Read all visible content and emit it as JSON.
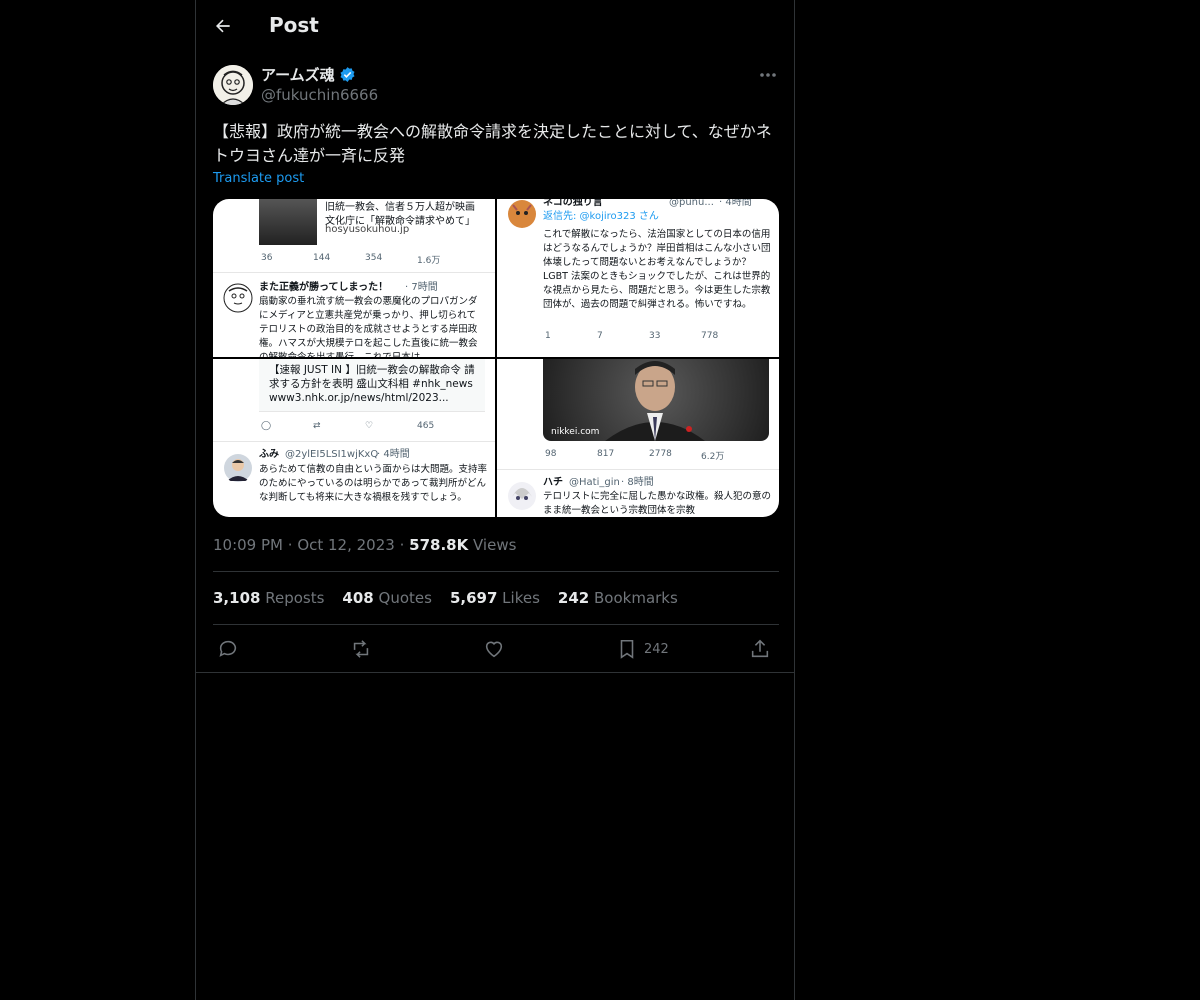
{
  "header": {
    "title": "Post"
  },
  "author": {
    "name": "アームズ魂",
    "handle": "@fukuchin6666"
  },
  "post": {
    "text": "【悲報】政府が統一教会への解散命令請求を決定したことに対して、なぜかネトウヨさん達が一斉に反発",
    "translate_label": "Translate post",
    "time": "10:09 PM",
    "date": "Oct 12, 2023",
    "views": "578.8K",
    "views_label": "Views"
  },
  "stats": {
    "reposts": "3,108",
    "reposts_label": "Reposts",
    "quotes": "408",
    "quotes_label": "Quotes",
    "likes": "5,697",
    "likes_label": "Likes",
    "bookmarks": "242",
    "bookmarks_label": "Bookmarks"
  },
  "actions": {
    "bookmark_count": "242"
  },
  "media": {
    "s1": {
      "card_title": "旧統一教会、信者５万人超が映画\n文化庁に「解散命令請求やめて」",
      "card_domain": "hosyusokuhou.jp",
      "m1": "36",
      "m2": "144",
      "m3": "354",
      "m4": "1.6万",
      "name": "また正義が勝ってしまった！",
      "time": "· 7時間",
      "body": "扇動家の垂れ流す統一教会の悪魔化のプロパガンダにメディアと立憲共産党が乗っかり、押し切られてテロリストの政治目的を成就させようとする岸田政権。ハマスが大規模テロを起こした直後に統一教会の解散命令を出す愚行、これで日本は"
    },
    "s2": {
      "name": "ネコの独り言",
      "handle": "@punu...",
      "time": "· 4時間",
      "reply_to": "返信先: @kojiro323 さん",
      "body": "これで解散になったら、法治国家としての日本の信用はどうなるんでしょうか？岸田首相はこんな小さい団体壊したって問題ないとお考えなんでしょうか？LGBT 法案のときもショックでしたが、これは世界的な視点から見たら、問題だと思う。今は更生した宗教団体が、過去の問題で糾弾される。怖いですね。",
      "m1": "1",
      "m2": "7",
      "m3": "33",
      "m4": "778"
    },
    "s3": {
      "card_text": "【速報 JUST IN 】旧統一教会の解散命令 請求する方針を表明 盛山文科相 #nhk_news www3.nhk.or.jp/news/html/2023...",
      "m4": "465",
      "name": "ふみ",
      "handle": "@2ylEI5LSI1wjKxQ",
      "time": "· 4時間",
      "body": "あらためて信教の自由という面からは大問題。支持率のためにやっているのは明らかであって裁判所がどんな判断しても将来に大きな禍根を残すでしょう。"
    },
    "s4": {
      "source": "nikkei.com",
      "m1": "98",
      "m2": "817",
      "m3": "2778",
      "m4": "6.2万",
      "name": "ハチ",
      "handle": "@Hati_gin",
      "time": "· 8時間",
      "body": "テロリストに完全に屈した愚かな政権。殺人犯の意のまま統一教会という宗教団体を宗教"
    }
  },
  "colors": {
    "accent": "#1d9bf0",
    "verified": "#1d9bf0",
    "muted": "#71767b",
    "border": "#2f3336"
  }
}
